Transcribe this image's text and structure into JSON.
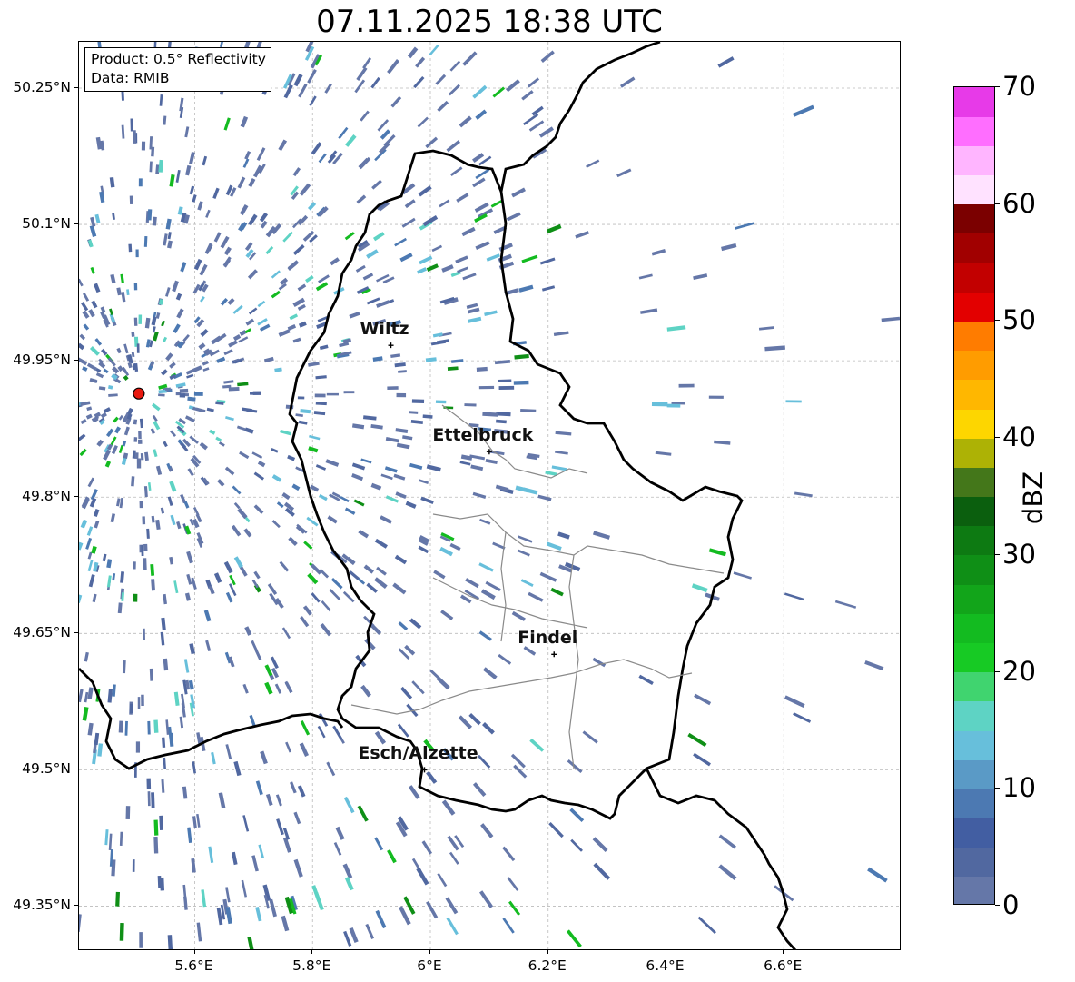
{
  "title": "07.11.2025 18:38 UTC",
  "info": {
    "product": "Product: 0.5° Reflectivity",
    "data_source": "Data: RMIB"
  },
  "map": {
    "lon_range": [
      5.4,
      6.8
    ],
    "lat_range": [
      49.3,
      50.3
    ],
    "lat_ticks": [
      {
        "value": 50.25,
        "label": "50.25°N"
      },
      {
        "value": 50.1,
        "label": "50.1°N"
      },
      {
        "value": 49.95,
        "label": "49.95°N"
      },
      {
        "value": 49.8,
        "label": "49.8°N"
      },
      {
        "value": 49.65,
        "label": "49.65°N"
      },
      {
        "value": 49.5,
        "label": "49.5°N"
      },
      {
        "value": 49.35,
        "label": "49.35°N"
      }
    ],
    "lon_ticks": [
      {
        "value": 5.6,
        "label": "5.6°E"
      },
      {
        "value": 5.8,
        "label": "5.8°E"
      },
      {
        "value": 6.0,
        "label": "6°E"
      },
      {
        "value": 6.2,
        "label": "6.2°E"
      },
      {
        "value": 6.4,
        "label": "6.4°E"
      },
      {
        "value": 6.6,
        "label": "6.6°E"
      }
    ],
    "radar_site": {
      "lon": 5.505,
      "lat": 49.914,
      "color": "#e8190f"
    },
    "cities": [
      {
        "name": "Wiltz",
        "lon": 5.933,
        "lat": 49.967
      },
      {
        "name": "Ettelbruck",
        "lon": 6.1,
        "lat": 49.85
      },
      {
        "name": "Findel",
        "lon": 6.21,
        "lat": 49.627
      },
      {
        "name": "Esch/Alzette",
        "lon": 5.99,
        "lat": 49.5
      }
    ]
  },
  "colorbar": {
    "label": "dBZ",
    "min": 0,
    "max": 70,
    "tick_labels": [
      "0",
      "10",
      "20",
      "30",
      "40",
      "50",
      "60",
      "70"
    ],
    "tick_values": [
      0,
      10,
      20,
      30,
      40,
      50,
      60,
      70
    ],
    "colors": [
      "#6577a8",
      "#5168a0",
      "#425ea2",
      "#4c79b2",
      "#5a9ac6",
      "#67bfdb",
      "#5ed3c4",
      "#40d46f",
      "#17ca24",
      "#13bb20",
      "#12a51a",
      "#0f8f16",
      "#0d7a12",
      "#0b5f0e",
      "#44771a",
      "#adb205",
      "#fdd600",
      "#ffb700",
      "#ff9c00",
      "#ff7c00",
      "#e30000",
      "#c20000",
      "#a10000",
      "#7b0000",
      "#ffe2ff",
      "#ffb5ff",
      "#ff6eff",
      "#e73ae8"
    ]
  }
}
